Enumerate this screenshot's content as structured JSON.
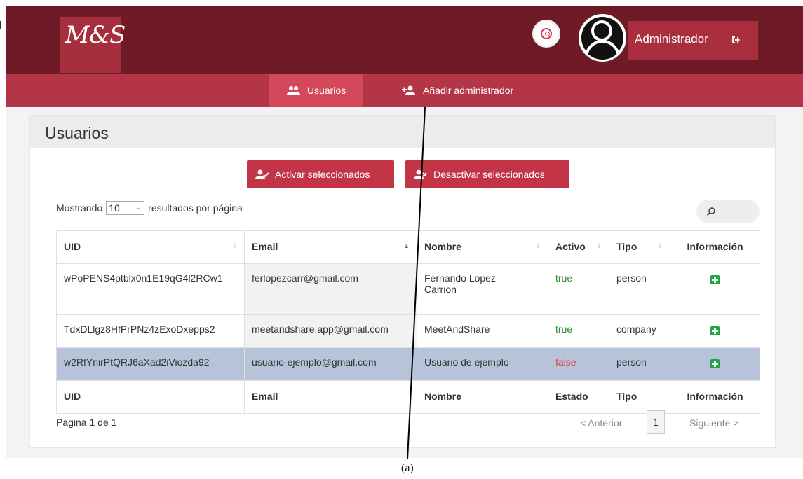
{
  "header": {
    "logo_text": "M&S",
    "user_label": "Administrador",
    "search_icon": "search-icon",
    "logout_icon": "logout-icon",
    "colors": {
      "topbar": "#6e1a27",
      "accent": "#b43545",
      "button": "#c23446"
    }
  },
  "nav": {
    "items": [
      {
        "label": "Usuarios",
        "icon": "users-icon"
      },
      {
        "label": "Añadir administrador",
        "icon": "add-user-icon"
      }
    ]
  },
  "panel": {
    "title": "Usuarios",
    "activate_label": "Activar seleccionados",
    "deactivate_label": "Desactivar seleccionados",
    "showing_prefix": "Mostrando",
    "page_size": "10",
    "showing_suffix": "resultados por página"
  },
  "table": {
    "headers": [
      "UID",
      "Email",
      "Nombre",
      "Activo",
      "Tipo",
      "Información"
    ],
    "rows": [
      {
        "uid": "wPoPENS4ptblx0n1E19qG4l2RCw1",
        "email": "ferlopezcarr@gmail.com",
        "name_line1": "Fernando Lopez",
        "name_line2": "Carrion",
        "active": "true",
        "type": "person"
      },
      {
        "uid": "TdxDLlgz8HfPrPNz4zExoDxepps2",
        "email": "meetandshare.app@gmail.com",
        "name": "MeetAndShare",
        "active": "true",
        "type": "company"
      },
      {
        "uid": "w2RfYnirPtQRJ6aXad2iViozda92",
        "email": "usuario-ejemplo@gmail.com",
        "name": "Usuario de ejemplo",
        "active": "false",
        "type": "person"
      }
    ],
    "footers": [
      "UID",
      "Email",
      "Nombre",
      "Estado",
      "Tipo",
      "Información"
    ]
  },
  "pagination": {
    "info": "Página 1 de 1",
    "prev": "< Anterior",
    "current": "1",
    "next": "Siguiente >"
  },
  "caption": "(a)"
}
